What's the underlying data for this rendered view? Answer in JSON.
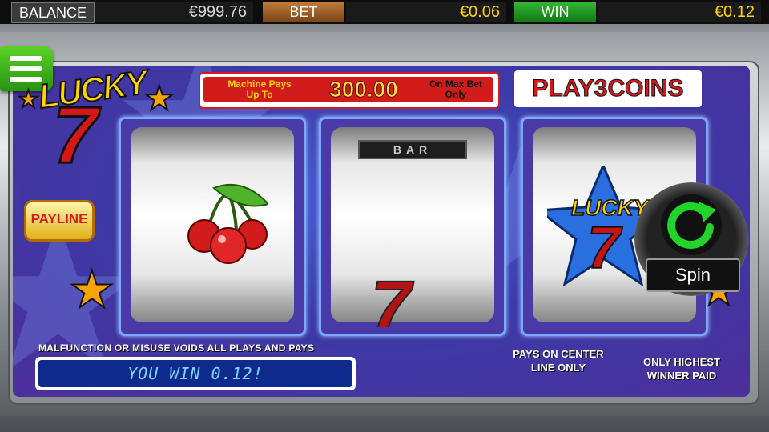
{
  "topbar": {
    "balance_label": "BALANCE",
    "balance_value": "€999.76",
    "bet_label": "BET",
    "bet_value": "€0.06",
    "win_label": "WIN",
    "win_value": "€0.12"
  },
  "logo": {
    "word": "LUCKY",
    "number": "7"
  },
  "header": {
    "max_pay_left": "Machine Pays Up To",
    "max_pay_value": "300.00",
    "max_pay_right": "On Max Bet Only",
    "play_coins": "PLAY3COINS"
  },
  "reels": [
    {
      "symbol": "cherry-icon"
    },
    {
      "symbols": [
        "BAR",
        "7"
      ]
    },
    {
      "symbol": "lucky7-icon",
      "text": "LUCKY 7"
    }
  ],
  "payline_label": "PAYLINE",
  "spin_label": "Spin",
  "footer": {
    "malfunction": "MALFUNCTION OR MISUSE VOIDS ALL PLAYS AND PAYS",
    "message": "YOU WIN 0.12!",
    "pays_center": "PAYS ON CENTER LINE ONLY",
    "only_highest": "ONLY HIGHEST WINNER PAID"
  },
  "colors": {
    "accent_red": "#d21b1b",
    "accent_yellow": "#ffd400",
    "panel_blue": "#3c3aa8",
    "win_green": "#279410"
  }
}
